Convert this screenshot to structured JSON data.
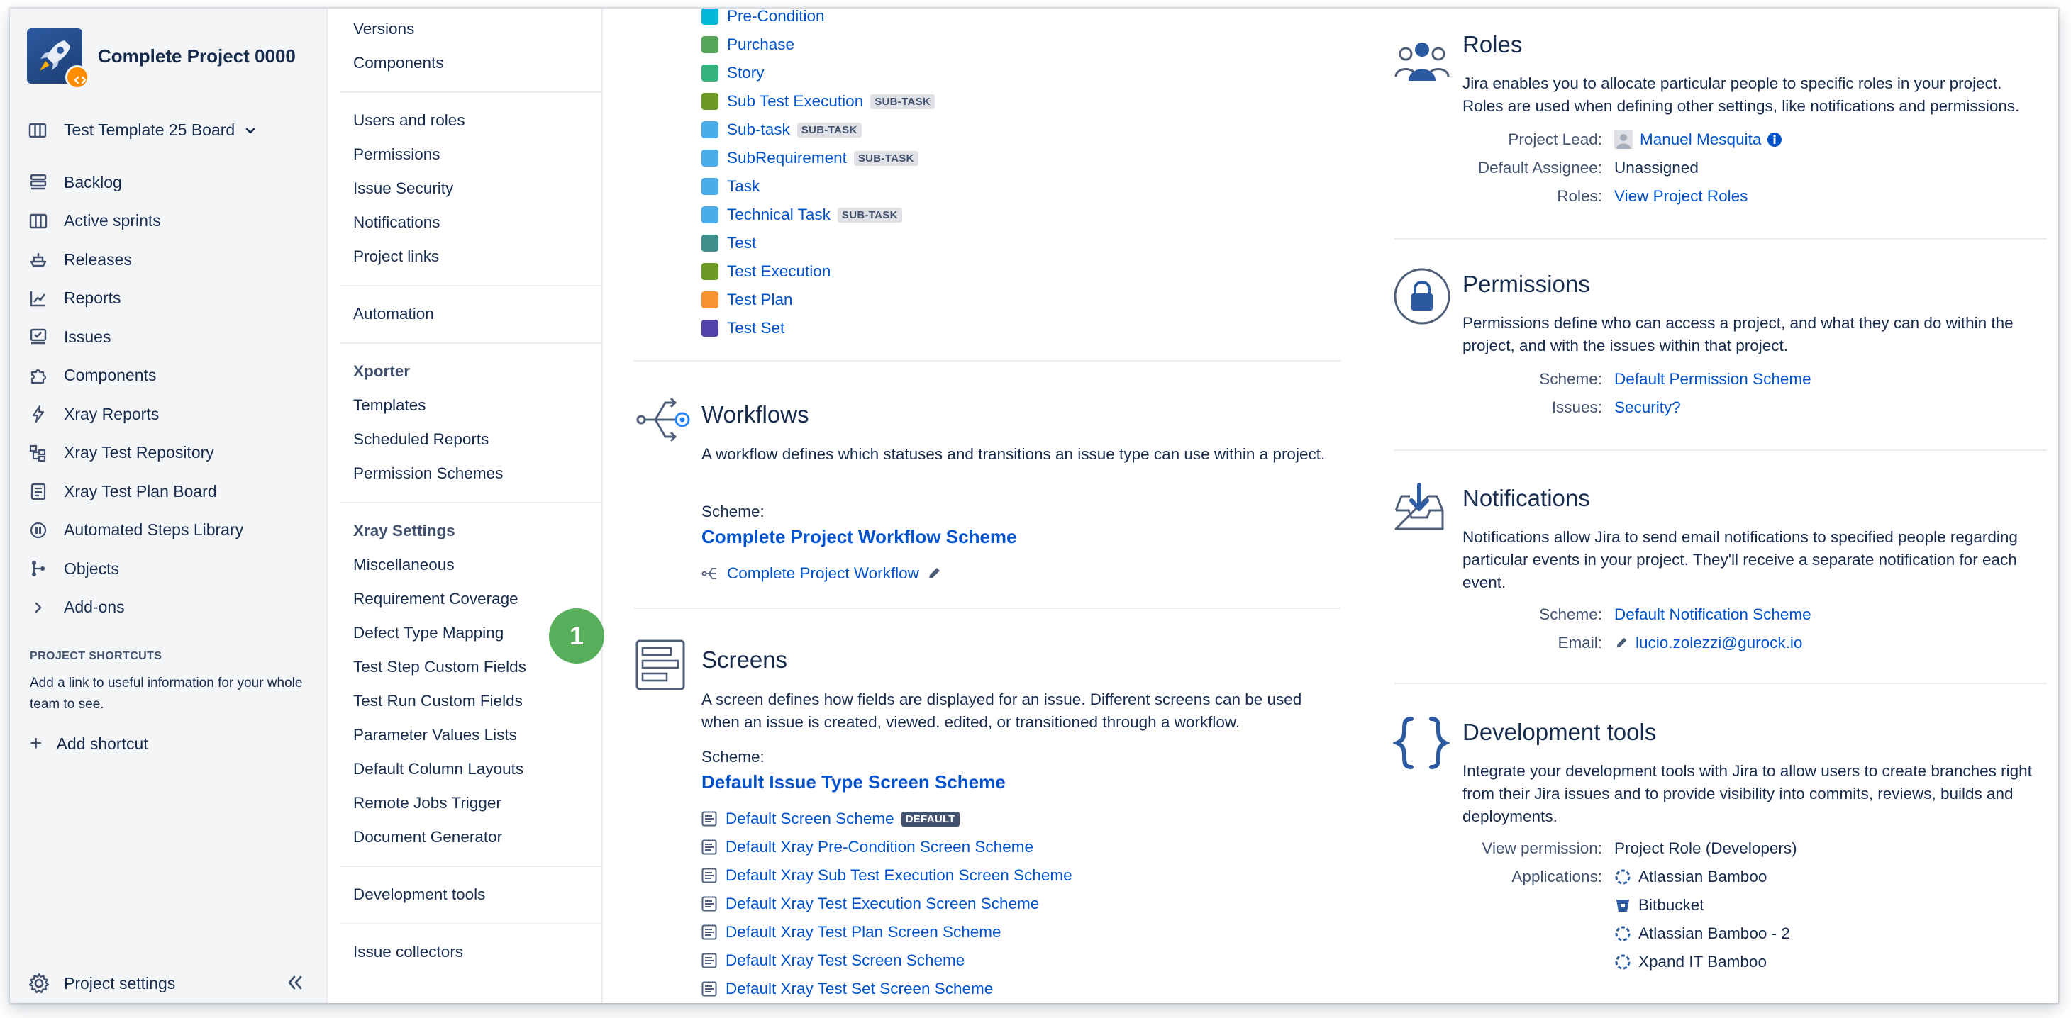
{
  "project": {
    "name": "Complete Project 0000"
  },
  "board": {
    "name": "Test Template 25 Board"
  },
  "nav": [
    {
      "label": "Backlog",
      "icon": "backlog-icon"
    },
    {
      "label": "Active sprints",
      "icon": "board-icon"
    },
    {
      "label": "Releases",
      "icon": "ship-icon"
    },
    {
      "label": "Reports",
      "icon": "chart-icon"
    },
    {
      "label": "Issues",
      "icon": "issues-icon"
    },
    {
      "label": "Components",
      "icon": "puzzle-icon"
    },
    {
      "label": "Xray Reports",
      "icon": "bolt-icon"
    },
    {
      "label": "Xray Test Repository",
      "icon": "repository-icon"
    },
    {
      "label": "Xray Test Plan Board",
      "icon": "testplan-icon"
    },
    {
      "label": "Automated Steps Library",
      "icon": "library-icon"
    },
    {
      "label": "Objects",
      "icon": "objects-icon"
    },
    {
      "label": "Add-ons",
      "icon": "chevron-right-icon"
    }
  ],
  "shortcuts": {
    "title": "PROJECT SHORTCUTS",
    "description": "Add a link to useful information for your whole team to see.",
    "add_label": "Add shortcut"
  },
  "footer": {
    "settings_label": "Project settings"
  },
  "settings_menu": {
    "items_a": [
      "Versions",
      "Components"
    ],
    "items_b": [
      "Users and roles",
      "Permissions",
      "Issue Security",
      "Notifications",
      "Project links"
    ],
    "automation": "Automation",
    "xporter_heading": "Xporter",
    "items_xporter": [
      "Templates",
      "Scheduled Reports",
      "Permission Schemes"
    ],
    "xray_heading": "Xray Settings",
    "items_xray": [
      "Miscellaneous",
      "Requirement Coverage",
      "Defect Type Mapping",
      "Test Step Custom Fields",
      "Test Run Custom Fields",
      "Parameter Values Lists",
      "Default Column Layouts",
      "Remote Jobs Trigger",
      "Document Generator"
    ],
    "dev_tools": "Development tools",
    "issue_collectors": "Issue collectors"
  },
  "step_badge": "1",
  "issue_types": [
    {
      "label": "Pre-Condition",
      "color": "#00b8d9",
      "lozenge": ""
    },
    {
      "label": "Purchase",
      "color": "#57a55a",
      "lozenge": ""
    },
    {
      "label": "Story",
      "color": "#36b37e",
      "lozenge": ""
    },
    {
      "label": "Sub Test Execution",
      "color": "#6a9a23",
      "lozenge": "SUB-TASK"
    },
    {
      "label": "Sub-task",
      "color": "#4bade8",
      "lozenge": "SUB-TASK"
    },
    {
      "label": "SubRequirement",
      "color": "#4bade8",
      "lozenge": "SUB-TASK"
    },
    {
      "label": "Task",
      "color": "#4bade8",
      "lozenge": ""
    },
    {
      "label": "Technical Task",
      "color": "#4bade8",
      "lozenge": "SUB-TASK"
    },
    {
      "label": "Test",
      "color": "#3f8f8a",
      "lozenge": ""
    },
    {
      "label": "Test Execution",
      "color": "#6a9a23",
      "lozenge": ""
    },
    {
      "label": "Test Plan",
      "color": "#f79232",
      "lozenge": ""
    },
    {
      "label": "Test Set",
      "color": "#5243aa",
      "lozenge": ""
    }
  ],
  "workflows": {
    "title": "Workflows",
    "description": "A workflow defines which statuses and transitions an issue type can use within a project.",
    "scheme_label": "Scheme:",
    "scheme_name": "Complete Project Workflow Scheme",
    "workflow": "Complete Project Workflow"
  },
  "screens": {
    "title": "Screens",
    "description": "A screen defines how fields are displayed for an issue. Different screens can be used when an issue is created, viewed, edited, or transitioned through a workflow.",
    "scheme_label": "Scheme:",
    "scheme_name": "Default Issue Type Screen Scheme",
    "schemes": [
      {
        "label": "Default Screen Scheme",
        "lozenge": "DEFAULT"
      },
      {
        "label": "Default Xray Pre-Condition Screen Scheme",
        "lozenge": ""
      },
      {
        "label": "Default Xray Sub Test Execution Screen Scheme",
        "lozenge": ""
      },
      {
        "label": "Default Xray Test Execution Screen Scheme",
        "lozenge": ""
      },
      {
        "label": "Default Xray Test Plan Screen Scheme",
        "lozenge": ""
      },
      {
        "label": "Default Xray Test Screen Scheme",
        "lozenge": ""
      },
      {
        "label": "Default Xray Test Set Screen Scheme",
        "lozenge": ""
      }
    ]
  },
  "roles": {
    "title": "Roles",
    "description": "Jira enables you to allocate particular people to specific roles in your project. Roles are used when defining other settings, like notifications and permissions.",
    "lead_label": "Project Lead:",
    "lead_value": "Manuel Mesquita",
    "assignee_label": "Default Assignee:",
    "assignee_value": "Unassigned",
    "roles_label": "Roles:",
    "roles_value": "View Project Roles"
  },
  "permissions": {
    "title": "Permissions",
    "description": "Permissions define who can access a project, and what they can do within the project, and with the issues within that project.",
    "scheme_label": "Scheme:",
    "scheme_value": "Default Permission Scheme",
    "issues_label": "Issues:",
    "issues_value": "Security?"
  },
  "notifications": {
    "title": "Notifications",
    "description": "Notifications allow Jira to send email notifications to specified people regarding particular events in your project. They'll receive a separate notification for each event.",
    "scheme_label": "Scheme:",
    "scheme_value": "Default Notification Scheme",
    "email_label": "Email:",
    "email_value": "lucio.zolezzi@gurock.io"
  },
  "devtools": {
    "title": "Development tools",
    "description": "Integrate your development tools with Jira to allow users to create branches right from their Jira issues and to provide visibility into commits, reviews, builds and deployments.",
    "view_label": "View permission:",
    "view_value": "Project Role (Developers)",
    "apps_label": "Applications:",
    "apps": [
      "Atlassian Bamboo",
      "Bitbucket",
      "Atlassian Bamboo - 2",
      "Xpand IT Bamboo"
    ]
  },
  "colors": {
    "link": "#0052cc",
    "text": "#172b4d",
    "subtle": "#42526e",
    "sidebar_bg": "#f4f5f7",
    "badge_green": "#57ae5b"
  }
}
